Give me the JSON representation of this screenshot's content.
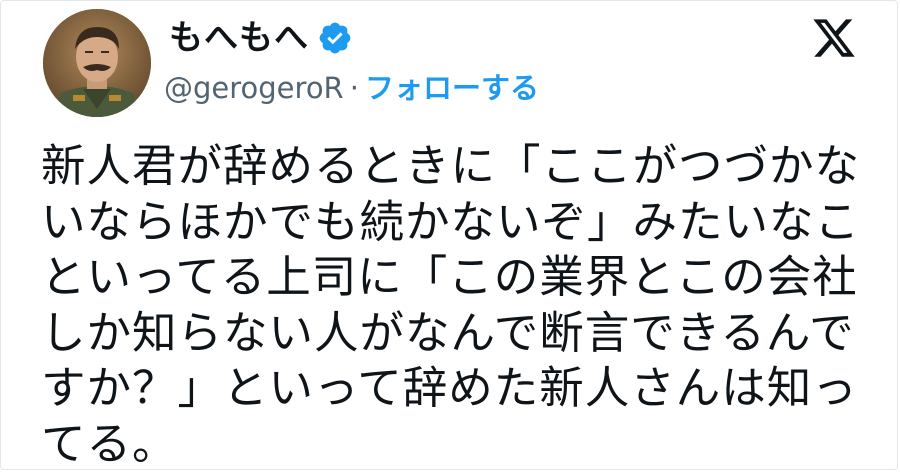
{
  "author": {
    "display_name": "もへもへ",
    "handle": "@gerogeroR",
    "separator": "·",
    "follow_label": "フォローする"
  },
  "icons": {
    "avatar": "avatar",
    "verified": "verified-badge-icon",
    "brand": "x-logo-icon"
  },
  "colors": {
    "accent": "#1d9bf0",
    "text": "#0f1419",
    "secondary": "#536471"
  },
  "tweet": {
    "lines": [
      "新人君が辞めるときに「ここがつづかな",
      "いならほかでも続かないぞ」みたいなこ",
      "といってる上司に「この業界とこの会社",
      "しか知らない人がなんで断言できるんで",
      "すか？」といって辞めた新人さんは知っ",
      "てる。"
    ]
  }
}
